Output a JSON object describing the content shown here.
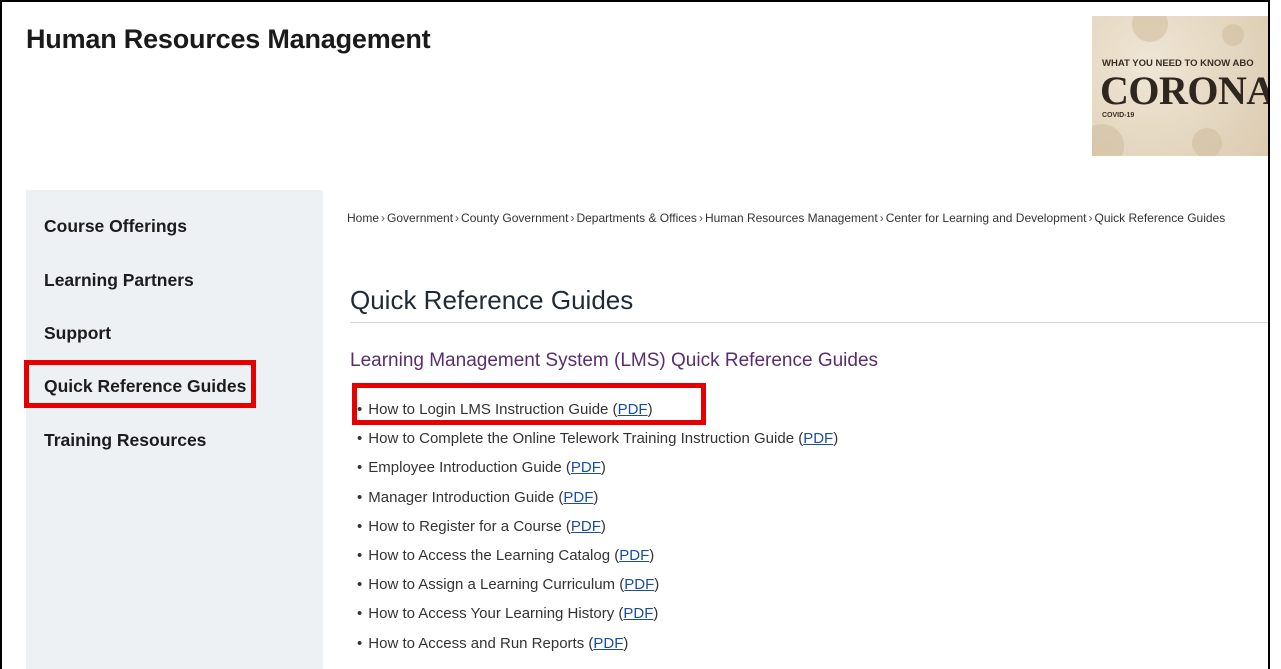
{
  "header": {
    "site_title": "Human Resources Management"
  },
  "banner": {
    "line1": "WHAT YOU NEED TO KNOW ABO",
    "line2": "CORONAVI",
    "line3": "COVID-19"
  },
  "sidebar": {
    "items": [
      {
        "label": "Course Offerings"
      },
      {
        "label": "Learning Partners"
      },
      {
        "label": "Support"
      },
      {
        "label": "Quick Reference Guides"
      },
      {
        "label": "Training Resources"
      }
    ],
    "highlighted_item": "Quick Reference Guides"
  },
  "breadcrumb": {
    "items": [
      "Home",
      "Government",
      "County Government",
      "Departments & Offices",
      "Human Resources Management",
      "Center for Learning and Development",
      "Quick Reference Guides"
    ],
    "separator": "›"
  },
  "main": {
    "page_title": "Quick Reference Guides",
    "section_title": "Learning Management System (LMS) Quick Reference Guides",
    "guides": [
      {
        "text": "How to Login LMS Instruction Guide",
        "link": "PDF"
      },
      {
        "text": "How to Complete the Online Telework Training Instruction Guide",
        "link": "PDF"
      },
      {
        "text": "Employee Introduction Guide",
        "link": "PDF"
      },
      {
        "text": "Manager Introduction Guide",
        "link": "PDF"
      },
      {
        "text": "How to Register for a Course",
        "link": "PDF"
      },
      {
        "text": "How to Access the Learning Catalog",
        "link": "PDF"
      },
      {
        "text": "How to Assign a Learning Curriculum",
        "link": "PDF"
      },
      {
        "text": "How to Access Your Learning History",
        "link": "PDF"
      },
      {
        "text": "How to Access and Run Reports",
        "link": "PDF"
      }
    ],
    "highlighted_guide": "How to Login LMS Instruction Guide"
  },
  "colors": {
    "highlight": "#e60000",
    "sidebar_bg": "#eef1f4",
    "section_heading": "#5a2d6e",
    "link": "#1a4ea0"
  }
}
